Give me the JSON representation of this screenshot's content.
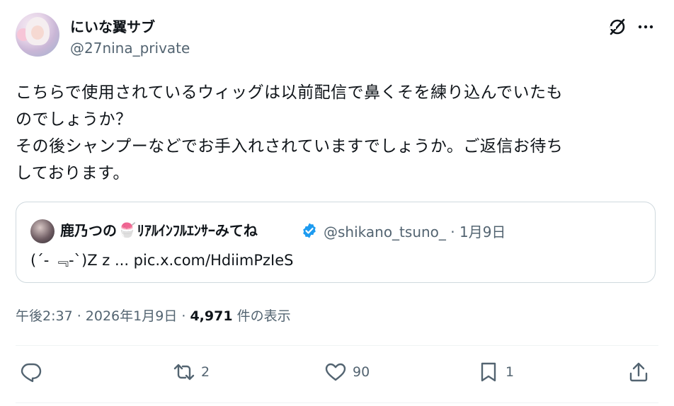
{
  "post": {
    "author_name": "にいな翼サブ",
    "author_handle": "@27nina_private",
    "body": "こちらで使用されているウィッグは以前配信で鼻くそを練り込んでいたも\nのでしょうか？\nその後シャンプーなどでお手入れされていますでしょうか。ご返信お待ち\nしております。"
  },
  "quote": {
    "name_part1": "鹿乃つの",
    "emoji": "🍧",
    "name_part2": "ﾘｱﾙｲﾝﾌﾙｴﾝｻｰみてね",
    "handle_date": "@shikano_tsuno_ · 1月9日",
    "text": "(´- ﹃-`)Z z ... pic.x.com/HdiimPzIeS"
  },
  "meta": {
    "time_date": "午後2:37 · 2026年1月9日 · ",
    "views": "4,971",
    "views_label": " 件の表示"
  },
  "actions": {
    "reply_count": "",
    "repost_count": "2",
    "like_count": "90",
    "bookmark_count": "1"
  },
  "icons": {
    "grok": "grok-icon",
    "more": "more-icon",
    "verified": "verified-badge-icon",
    "reply": "reply-icon",
    "repost": "repost-icon",
    "like": "heart-icon",
    "bookmark": "bookmark-icon",
    "share": "share-icon"
  },
  "colors": {
    "text": "#0f1419",
    "secondary": "#536471",
    "verified": "#1d9bf0",
    "border": "#cfd9de"
  }
}
